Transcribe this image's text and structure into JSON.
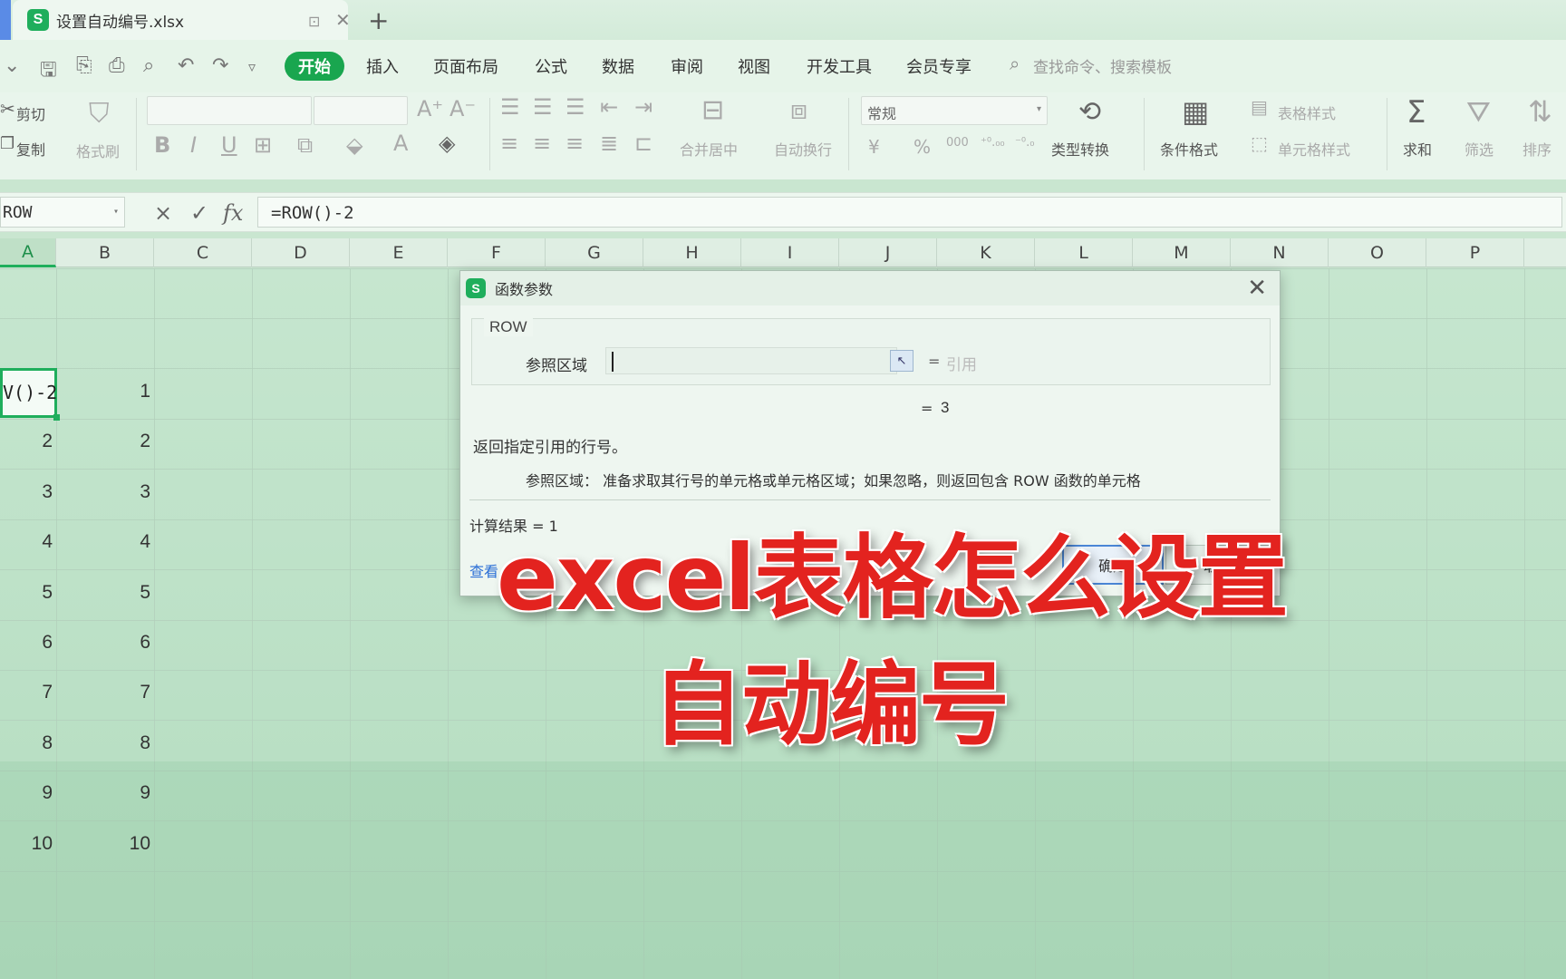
{
  "tab": {
    "logo": "S",
    "filename": "设置自动编号.xlsx",
    "pin_icon": "pin-icon",
    "close_icon": "close-icon",
    "new_tab": "+"
  },
  "menu": {
    "items": [
      "开始",
      "插入",
      "页面布局",
      "公式",
      "数据",
      "审阅",
      "视图",
      "开发工具",
      "会员专享"
    ],
    "search_placeholder": "查找命令、搜索模板",
    "accent_color": "#19a64f"
  },
  "ribbon": {
    "cut": "剪切",
    "copy": "复制",
    "format_painter": "格式刷",
    "font_grow": "A⁺",
    "font_shrink": "A⁻",
    "bold": "B",
    "italic": "I",
    "underline": "U",
    "merge_center": "合并居中",
    "wrap_text": "自动换行",
    "number_format": "常规",
    "currency": "¥",
    "percent": "%",
    "thousands": "000",
    "inc_decimal": "⁺⁰.₀₀",
    "dec_decimal": "⁻⁰.₀",
    "type_convert": "类型转换",
    "cond_format": "条件格式",
    "table_style": "表格样式",
    "cell_style": "单元格样式",
    "sum": "求和",
    "filter": "筛选",
    "sort": "排序"
  },
  "formula_bar": {
    "name_box": "ROW",
    "cancel": "×",
    "confirm": "✓",
    "fx": "fx",
    "formula": "=ROW()-2"
  },
  "sheet": {
    "columns": [
      "A",
      "B",
      "C",
      "D",
      "E",
      "F",
      "G",
      "H",
      "I",
      "J",
      "K",
      "L",
      "M",
      "N",
      "O",
      "P"
    ],
    "active_column": "A",
    "active_cell_text": "V()-2",
    "col_a_values": [
      "2",
      "3",
      "4",
      "5",
      "6",
      "7",
      "8",
      "9",
      "10"
    ],
    "col_b_values": [
      "1",
      "2",
      "3",
      "4",
      "5",
      "6",
      "7",
      "8",
      "9",
      "10"
    ]
  },
  "dialog": {
    "logo": "S",
    "title": "函数参数",
    "function_name": "ROW",
    "arg_label": "参照区域",
    "arg_value": "",
    "arg_eq": "=",
    "arg_hint": "引用",
    "result_eq": "=",
    "result_value": "3",
    "description": "返回指定引用的行号。",
    "arg_description": "参照区域：   准备求取其行号的单元格或单元格区域；如果忽略，则返回包含 ROW 函数的单元格",
    "calc_result": "计算结果  =  1",
    "help_link": "查看",
    "ok": "确定",
    "cancel": "取消"
  },
  "overlay": {
    "line1": "excel表格怎么设置",
    "line2": "自动编号",
    "color": "#e3231f"
  }
}
